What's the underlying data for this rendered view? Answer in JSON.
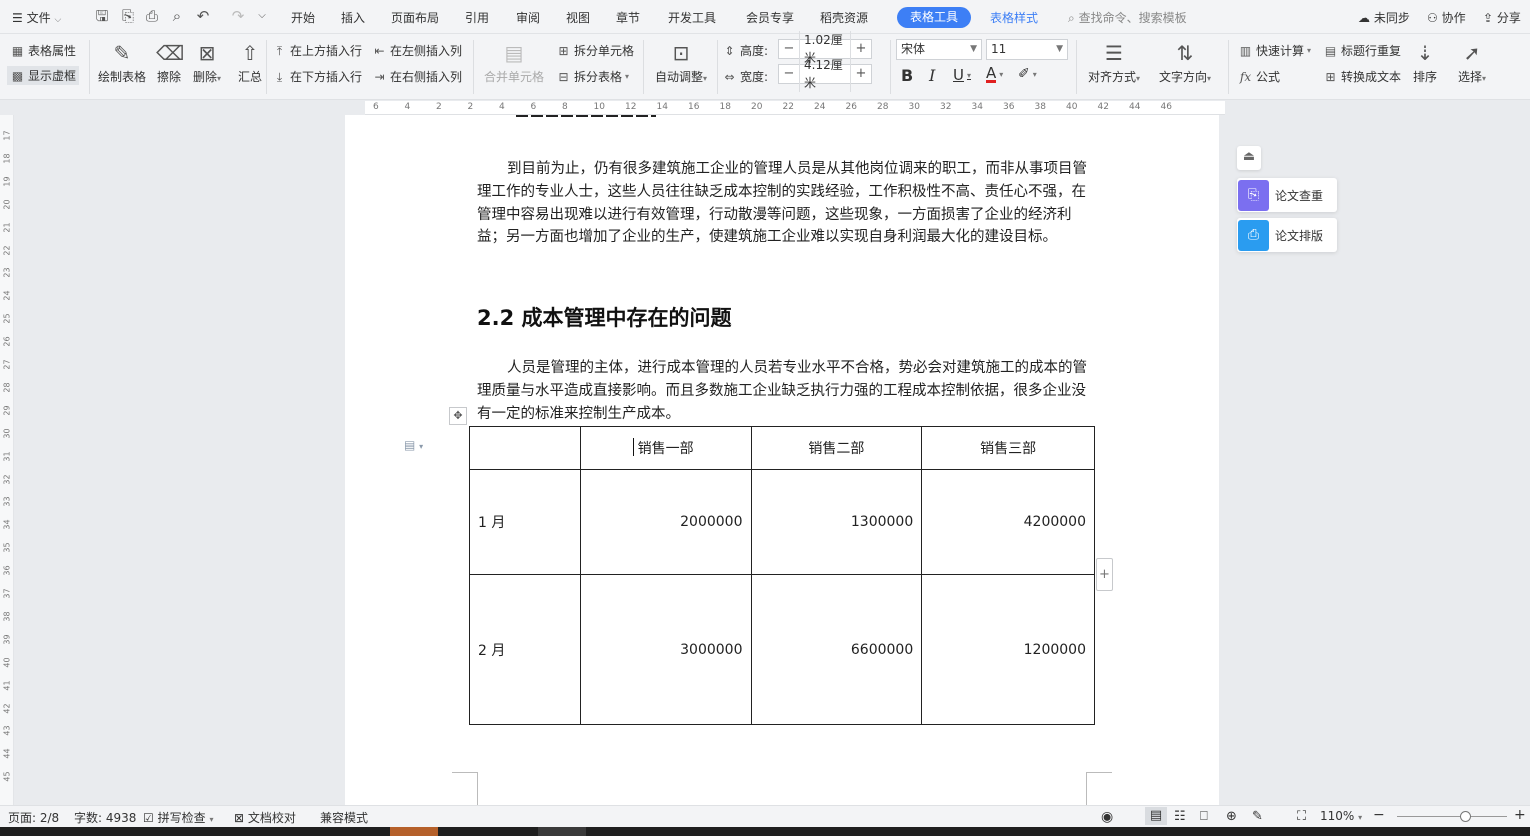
{
  "menubar": {
    "file": "文件",
    "tabs": [
      "开始",
      "插入",
      "页面布局",
      "引用",
      "审阅",
      "视图",
      "章节",
      "开发工具",
      "会员专享",
      "稻壳资源"
    ],
    "active_tab": "表格工具",
    "tab_style": "表格样式",
    "search_placeholder": "查找命令、搜索模板",
    "sync": "未同步",
    "collab": "协作",
    "share": "分享"
  },
  "ribbon": {
    "table_props": "表格属性",
    "show_gridlines": "显示虚框",
    "draw_table": "绘制表格",
    "erase": "擦除",
    "delete": "删除",
    "summary": "汇总",
    "insert_above": "在上方插入行",
    "insert_below": "在下方插入行",
    "insert_left": "在左侧插入列",
    "insert_right": "在右侧插入列",
    "merge_cells": "合并单元格",
    "split_cells": "拆分单元格",
    "split_table": "拆分表格",
    "auto_adjust": "自动调整",
    "height_label": "高度:",
    "height_value": "1.02厘米",
    "width_label": "宽度:",
    "width_value": "4.12厘米",
    "font_name": "宋体",
    "font_size": "11",
    "bold": "B",
    "italic": "I",
    "underline": "U",
    "font_color": "A",
    "align": "对齐方式",
    "text_dir": "文字方向",
    "quick_calc": "快速计算",
    "formula": "公式",
    "title_repeat": "标题行重复",
    "to_text": "转换成文本",
    "sort": "排序",
    "select": "选择"
  },
  "ruler_marks": [
    "6",
    "4",
    "2",
    "2",
    "4",
    "6",
    "8",
    "10",
    "12",
    "14",
    "16",
    "18",
    "20",
    "22",
    "24",
    "26",
    "28",
    "30",
    "32",
    "34",
    "36",
    "38",
    "40",
    "42",
    "44",
    "46"
  ],
  "vruler_marks": [
    "17",
    "18",
    "19",
    "20",
    "21",
    "22",
    "23",
    "24",
    "25",
    "26",
    "27",
    "28",
    "29",
    "30",
    "31",
    "32",
    "33",
    "34",
    "35",
    "36",
    "37",
    "38",
    "39",
    "40",
    "41",
    "42",
    "43",
    "44",
    "45"
  ],
  "document": {
    "para1": "到目前为止，仍有很多建筑施工企业的管理人员是从其他岗位调来的职工，而非从事项目管理工作的专业人士，这些人员往往缺乏成本控制的实践经验，工作积极性不高、责任心不强，在管理中容易出现难以进行有效管理，行动散漫等问题，这些现象，一方面损害了企业的经济利益；另一方面也增加了企业的生产，使建筑施工企业难以实现自身利润最大化的建设目标。",
    "heading": "2.2 成本管理中存在的问题",
    "para2": "人员是管理的主体，进行成本管理的人员若专业水平不合格，势必会对建筑施工的成本的管理质量与水平造成直接影响。而且多数施工企业缺乏执行力强的工程成本控制依据，很多企业没有一定的标准来控制生产成本。",
    "table": {
      "headers": [
        "",
        "销售一部",
        "销售二部",
        "销售三部"
      ],
      "rows": [
        [
          "1 月",
          "2000000",
          "1300000",
          "4200000"
        ],
        [
          "2 月",
          "3000000",
          "6600000",
          "1200000"
        ]
      ]
    }
  },
  "side_panel": {
    "check": "论文查重",
    "layout": "论文排版"
  },
  "status": {
    "page": "页面: 2/8",
    "words": "字数: 4938",
    "spell": "拼写检查",
    "proof": "文档校对",
    "compat": "兼容模式",
    "zoom": "110%"
  },
  "colors": {
    "accent": "#3d7ff5",
    "check_icon": "#7b6ff0",
    "layout_icon": "#2a9cf0"
  }
}
